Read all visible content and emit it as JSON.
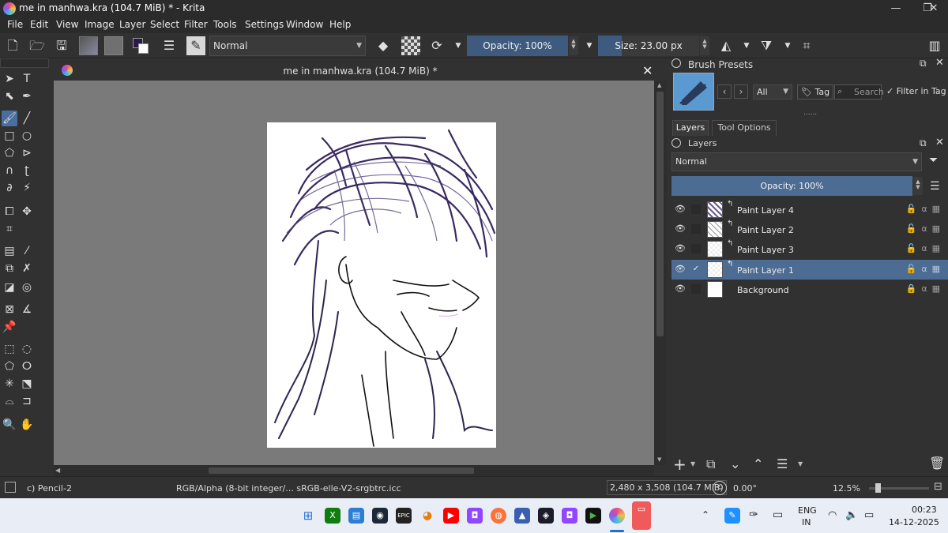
{
  "window": {
    "title": "me in manhwa.kra (104.7 MiB) * - Krita",
    "minimize": "—",
    "maximize": "❐",
    "close": "✕"
  },
  "menu": [
    "File",
    "Edit",
    "View",
    "Image",
    "Layer",
    "Select",
    "Filter",
    "Tools",
    "Settings",
    "Window",
    "Help"
  ],
  "toolbar": {
    "blend_mode": "Normal",
    "opacity": "Opacity: 100%",
    "size": "Size: 23.00 px"
  },
  "document": {
    "title": "me in manhwa.kra (104.7 MiB) *",
    "close": "✕"
  },
  "brush_presets": {
    "title": "Brush Presets",
    "filter_value": "All",
    "tag_label": "Tag",
    "search_placeholder": "Search",
    "filter_in_tag": "Filter in Tag",
    "dots": "......"
  },
  "tabs": [
    "Layers",
    "Tool Options"
  ],
  "layers": {
    "title": "Layers",
    "blend_mode": "Normal",
    "opacity": "Opacity:  100%",
    "items": [
      {
        "name": "Paint Layer 4",
        "selected": false,
        "checked": false
      },
      {
        "name": "Paint Layer 2",
        "selected": false,
        "checked": false
      },
      {
        "name": "Paint Layer 3",
        "selected": false,
        "checked": false
      },
      {
        "name": "Paint Layer 1",
        "selected": true,
        "checked": true
      },
      {
        "name": "Background",
        "selected": false,
        "checked": false
      }
    ]
  },
  "status": {
    "brush": "c) Pencil-2",
    "color_space": "RGB/Alpha (8-bit integer/... sRGB-elle-V2-srgbtrc.icc",
    "image_size": "2,480 x 3,508 (104.7 MiB)",
    "rotation": "0.00°",
    "zoom": "12.5%"
  },
  "taskbar": {
    "language": "ENG",
    "region": "IN",
    "time": "00:23",
    "date": "14-12-2025"
  },
  "colors": {
    "accent": "#4d6c94",
    "slider": "#3e5a7e",
    "canvas_bg": "#7a7a7a",
    "panel": "#313131"
  }
}
